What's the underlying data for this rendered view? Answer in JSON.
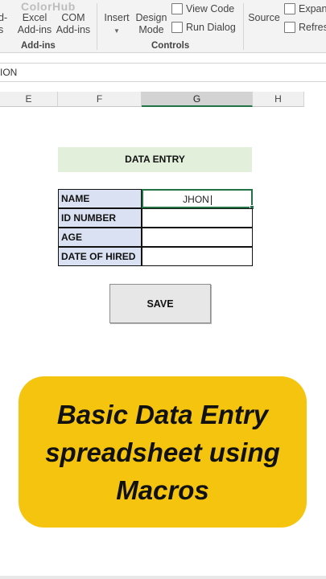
{
  "ribbon": {
    "watermark": "ColorHub",
    "addins_cut": "d-\ns",
    "excel_addins": "Excel\nAdd-ins",
    "com_addins": "COM\nAdd-ins",
    "insert": "Insert",
    "design_mode": "Design\nMode",
    "view_code": "View Code",
    "run_dialog": "Run Dialog",
    "source": "Source",
    "expand": "Expan",
    "refresh": "Refres",
    "group_addins": "Add-ins",
    "group_controls": "Controls"
  },
  "namebar": {
    "text": "ION"
  },
  "columns": [
    "E",
    "F",
    "G",
    "H"
  ],
  "sheet": {
    "title": "DATA ENTRY",
    "rows": [
      {
        "label": "NAME",
        "value": "JHON"
      },
      {
        "label": "ID NUMBER",
        "value": ""
      },
      {
        "label": "AGE",
        "value": ""
      },
      {
        "label": "DATE OF HIRED",
        "value": ""
      }
    ],
    "save_label": "SAVE"
  },
  "banner": {
    "line1": "Basic Data Entry",
    "line2": "spreadsheet using",
    "line3": "Macros"
  },
  "colors": {
    "accent": "#217346",
    "banner": "#f4c40f",
    "title_fill": "#e2efda",
    "label_fill": "#d9e1f2"
  }
}
